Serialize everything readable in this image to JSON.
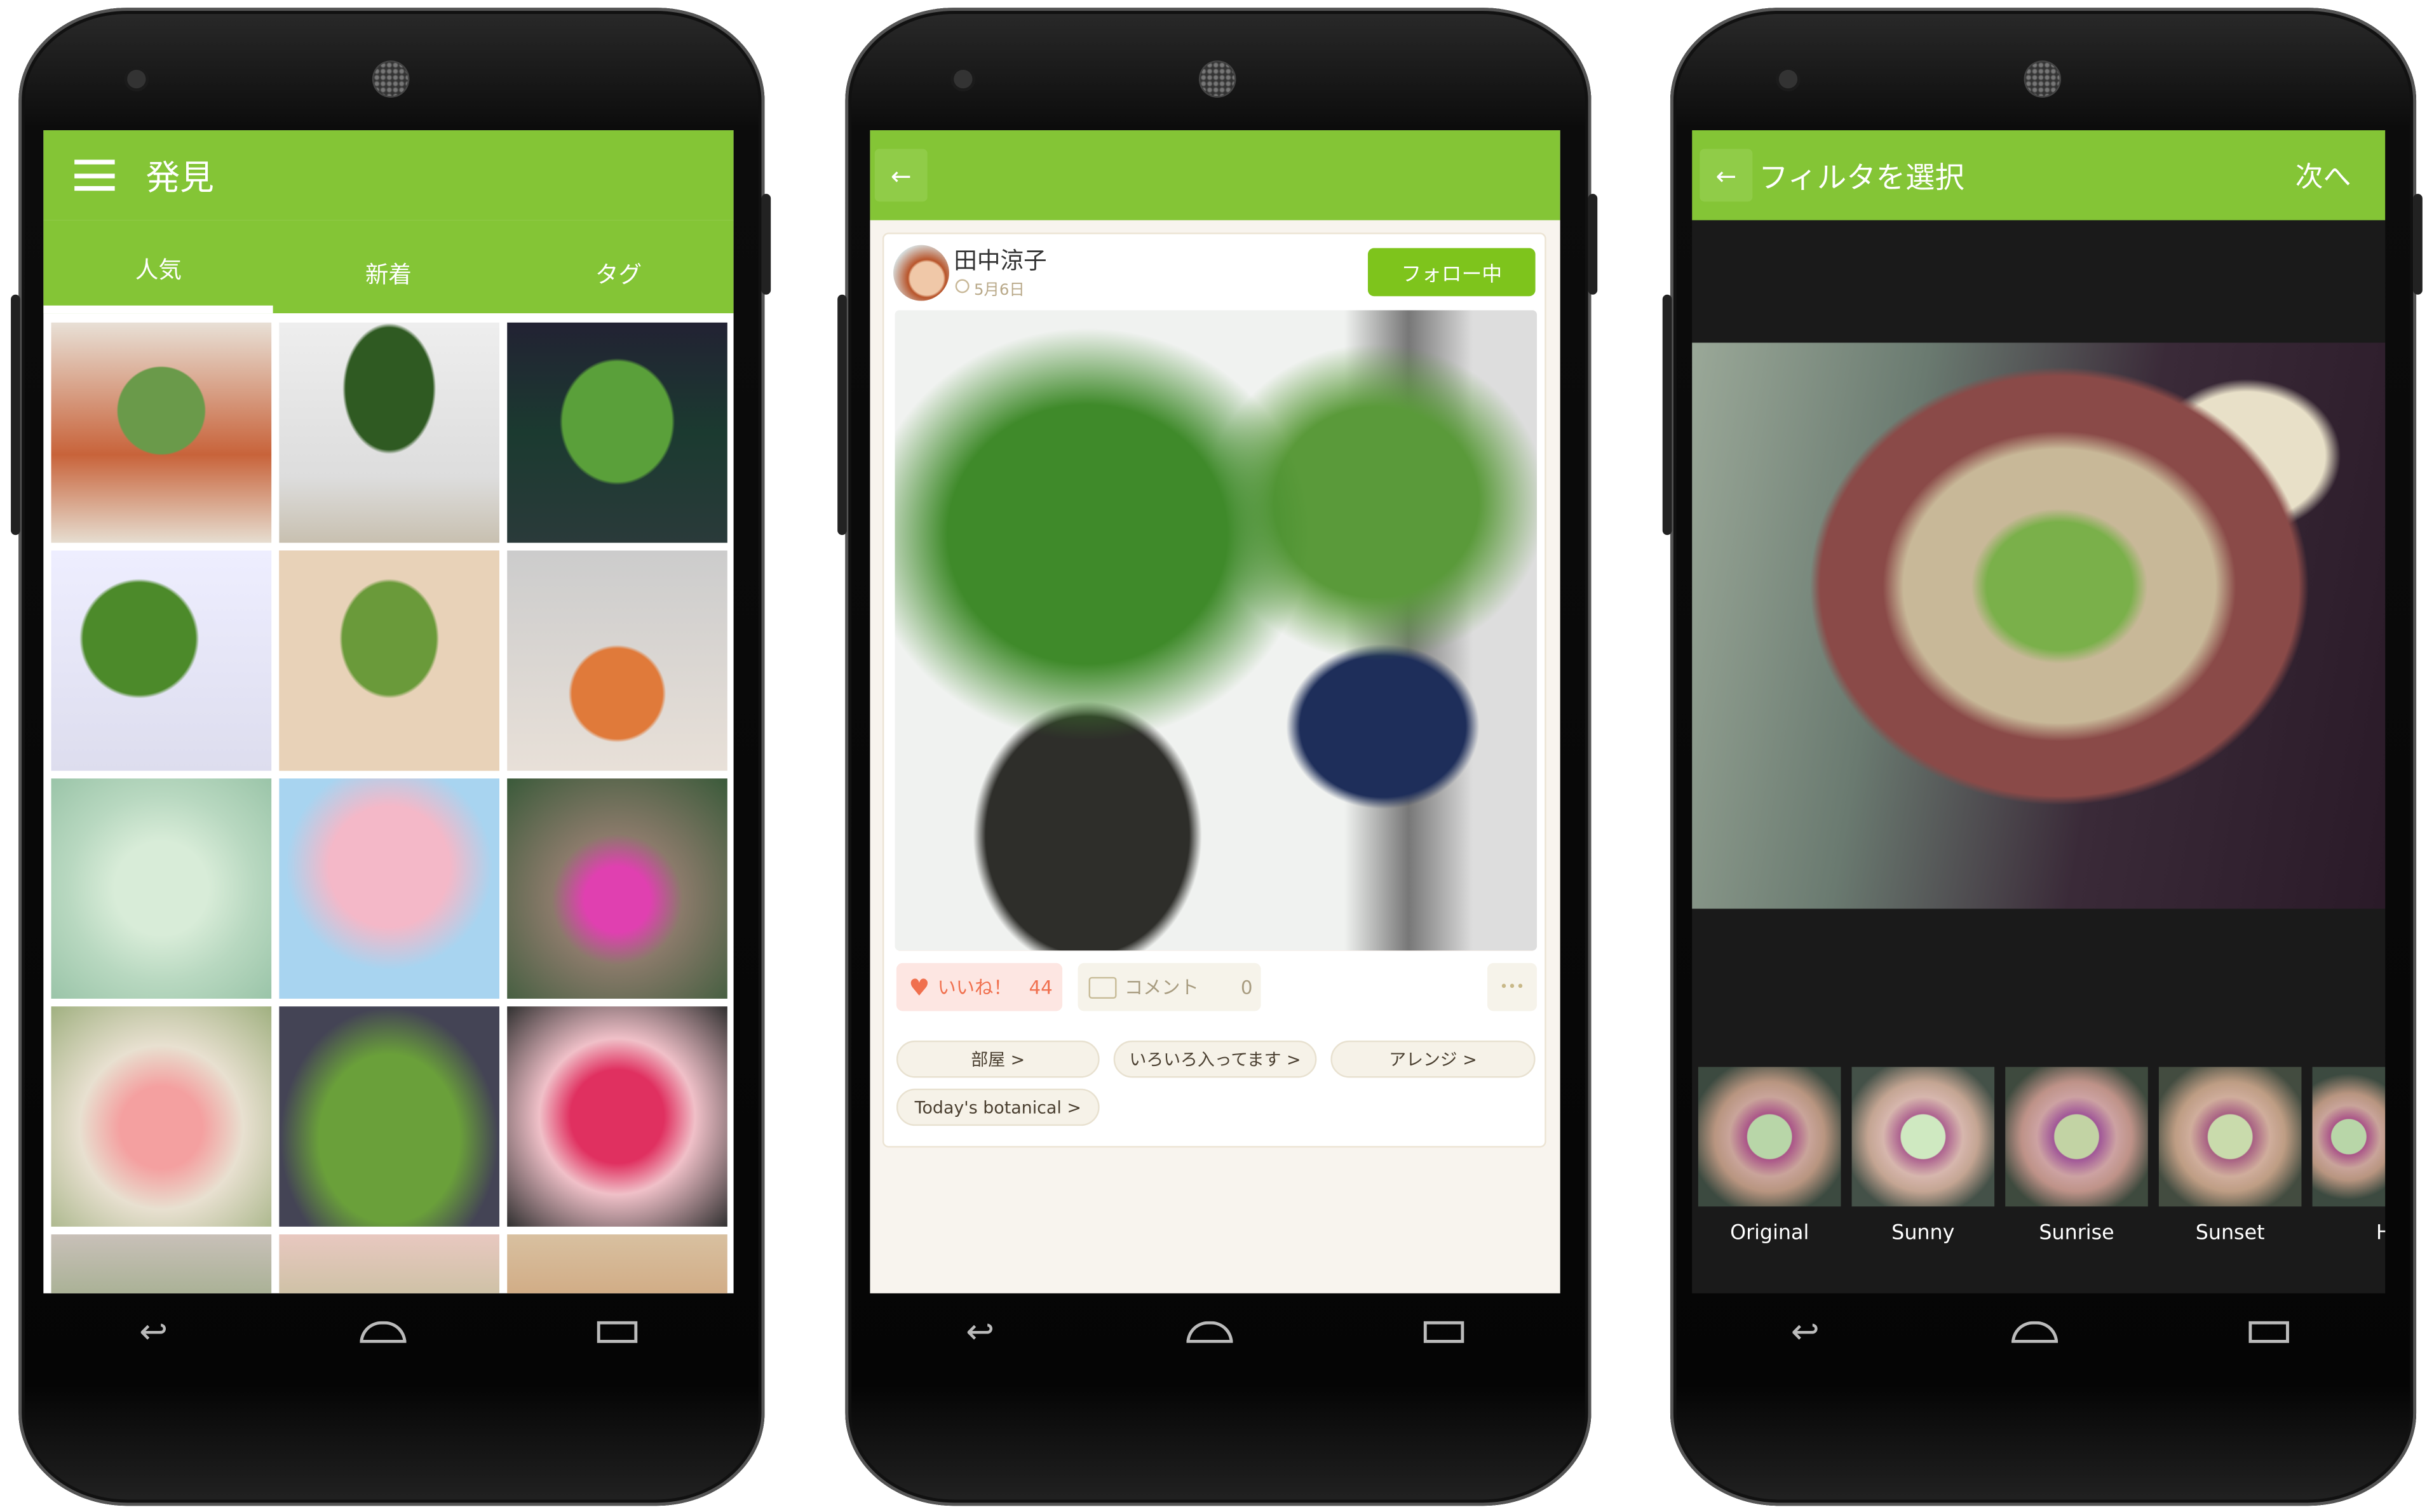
{
  "screen1": {
    "title": "発見",
    "menu_icon": "hamburger-menu-icon",
    "tabs": [
      {
        "label": "人気",
        "active": true
      },
      {
        "label": "新着",
        "active": false
      },
      {
        "label": "タグ",
        "active": false
      }
    ],
    "accent": "#84c536"
  },
  "screen2": {
    "back_icon": "arrow-left-icon",
    "post": {
      "user_name": "田中涼子",
      "date": "5月6日",
      "follow_label": "フォロー中",
      "like_label": "いいね！",
      "like_count": "44",
      "comment_label": "コメント",
      "comment_count": "0",
      "more_label": "•••",
      "tags": [
        "部屋 >",
        "いろいろ入ってます >",
        "アレンジ >",
        "Today's botanical >"
      ]
    },
    "like_color": "#f0704e"
  },
  "screen3": {
    "title": "フィルタを選択",
    "next_label": "次へ",
    "filters": [
      "Original",
      "Sunny",
      "Sunrise",
      "Sunset",
      "H"
    ]
  },
  "nav": {
    "back_icon": "back-icon",
    "home_icon": "home-icon",
    "recents_icon": "recents-icon"
  }
}
